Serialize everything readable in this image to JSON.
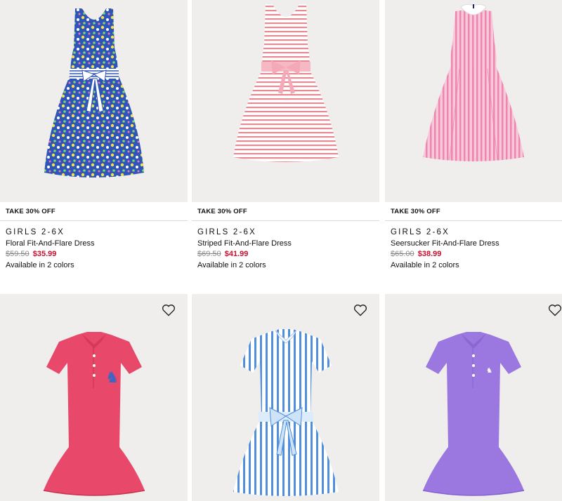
{
  "products": [
    {
      "promo": "TAKE 30% OFF",
      "category": "GIRLS 2-6X",
      "name": "Floral Fit-And-Flare Dress",
      "original_price": "$59.50",
      "sale_price": "$35.99",
      "availability": "Available in 2 colors",
      "image": "floral-dress-image"
    },
    {
      "promo": "TAKE 30% OFF",
      "category": "GIRLS 2-6X",
      "name": "Striped Fit-And-Flare Dress",
      "original_price": "$69.50",
      "sale_price": "$41.99",
      "availability": "Available in 2 colors",
      "image": "striped-dress-image"
    },
    {
      "promo": "TAKE 30% OFF",
      "category": "GIRLS 2-6X",
      "name": "Seersucker Fit-And-Flare Dress",
      "original_price": "$65.00",
      "sale_price": "$38.99",
      "availability": "Available in 2 colors",
      "image": "seersucker-dress-image"
    },
    {
      "image": "pink-polo-dress-image",
      "wishlist_icon": "heart-icon"
    },
    {
      "image": "blue-stripe-shirtdress-image",
      "wishlist_icon": "heart-icon"
    },
    {
      "image": "purple-polo-dress-image",
      "wishlist_icon": "heart-icon"
    }
  ],
  "colors": {
    "sale_red": "#c8102e",
    "photo_bg": "#efeeed",
    "strike_gray": "#8a8a8a"
  }
}
